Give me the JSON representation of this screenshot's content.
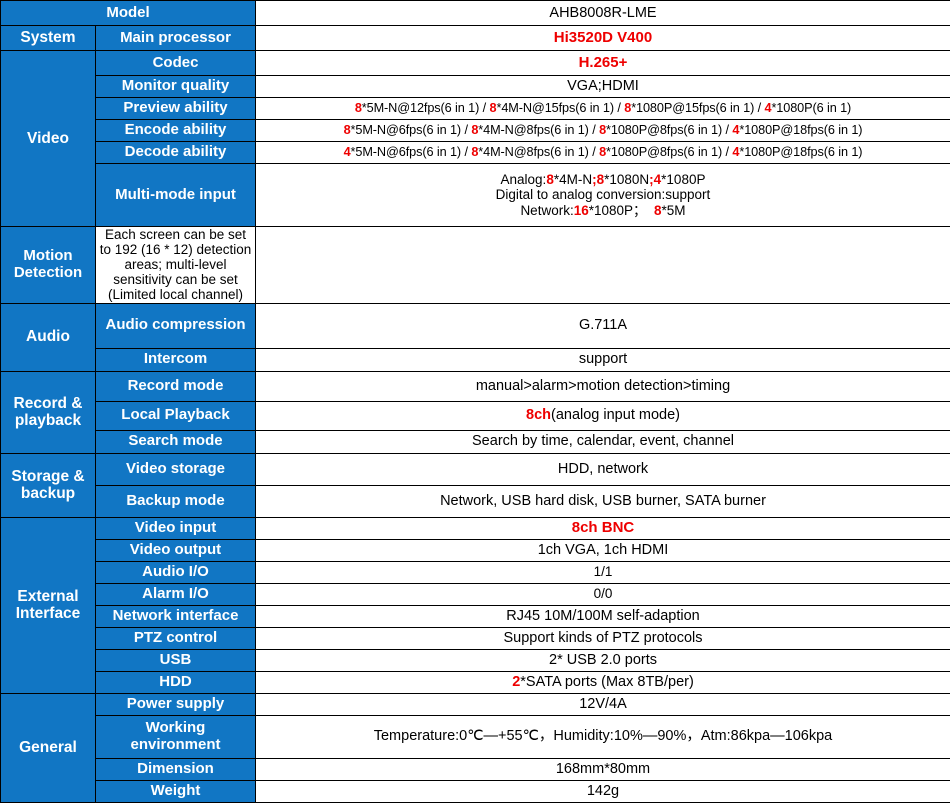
{
  "colors": {
    "label_blue": "#1176c4",
    "label_text": "#ffffff",
    "accent_red": "#ee0000",
    "border": "#000000",
    "value_bg": "#ffffff"
  },
  "categories": {
    "system": "System",
    "video": "Video",
    "audio": "Audio",
    "record_playback": "Record & playback",
    "storage_backup": "Storage & backup",
    "external_interface": "External Interface",
    "general": "General"
  },
  "rows": {
    "model": {
      "label": "Model",
      "value": "AHB8008R-LME"
    },
    "main_processor": {
      "label": "Main processor",
      "value": "Hi3520D V400"
    },
    "codec": {
      "label": "Codec",
      "value": "H.265+"
    },
    "monitor_quality": {
      "label": "Monitor quality",
      "value": "VGA;HDMI"
    },
    "preview_ability": {
      "label": "Preview ability",
      "value": "8*5M-N@12fps(6 in 1) / 8*4M-N@15fps(6 in 1) / 8*1080P@15fps(6 in 1) / 4*1080P(6 in 1)",
      "segments": [
        {
          "red": "8",
          "black": "*5M-N@12fps(6 in 1) / "
        },
        {
          "red": "8",
          "black": "*4M-N@15fps(6 in 1) / "
        },
        {
          "red": "8",
          "black": "*1080P@15fps(6 in 1) / "
        },
        {
          "red": "4",
          "black": "*1080P(6 in 1)"
        }
      ]
    },
    "encode_ability": {
      "label": "Encode ability",
      "value": "8*5M-N@6fps(6 in 1) / 8*4M-N@8fps(6 in 1) / 8*1080P@8fps(6 in 1) / 4*1080P@18fps(6 in 1)",
      "segments": [
        {
          "red": "8",
          "black": "*5M-N@6fps(6 in 1) / "
        },
        {
          "red": "8",
          "black": "*4M-N@8fps(6 in 1) / "
        },
        {
          "red": "8",
          "black": "*1080P@8fps(6 in 1) / "
        },
        {
          "red": "4",
          "black": "*1080P@18fps(6 in 1)"
        }
      ]
    },
    "decode_ability": {
      "label": "Decode ability",
      "value": "4*5M-N@6fps(6 in 1) / 8*4M-N@8fps(6 in 1) / 8*1080P@8fps(6 in 1) / 4*1080P@18fps(6 in 1)",
      "segments": [
        {
          "red": "4",
          "black": "*5M-N@6fps(6 in 1) / "
        },
        {
          "red": "8",
          "black": "*4M-N@8fps(6 in 1) / "
        },
        {
          "red": "8",
          "black": "*1080P@8fps(6 in 1) / "
        },
        {
          "red": "4",
          "black": "*1080P@18fps(6 in 1)"
        }
      ]
    },
    "multi_mode_input": {
      "label": "Multi-mode input",
      "line1_prefix": "Analog:",
      "line1_red1": "8",
      "line1_mid1": "*4M-N",
      "line1_semi1": ";",
      "line1_red2": "8",
      "line1_mid2": "*1080N",
      "line1_semi2": ";",
      "line1_red3": "4",
      "line1_end": "*1080P",
      "line2": "Digital to analog conversion:support",
      "line3_prefix": "Network:",
      "line3_red1": "16",
      "line3_mid": "*1080P；  ",
      "line3_red2": "8",
      "line3_end": "*5M"
    },
    "motion_detection": {
      "label": "Motion Detection",
      "value": "Each screen can be set to 192 (16 * 12) detection areas; multi-level sensitivity can be set (Limited local channel)"
    },
    "audio_compression": {
      "label": "Audio compression",
      "value": "G.711A"
    },
    "intercom": {
      "label": "Intercom",
      "value": "support"
    },
    "record_mode": {
      "label": "Record mode",
      "value": "manual>alarm>motion detection>timing"
    },
    "local_playback": {
      "label": "Local Playback",
      "value_red": "8ch",
      "value_black": "(analog input mode)"
    },
    "search_mode": {
      "label": "Search mode",
      "value": "Search by time, calendar, event, channel"
    },
    "video_storage": {
      "label": "Video storage",
      "value": "HDD, network"
    },
    "backup_mode": {
      "label": "Backup mode",
      "value": "Network, USB hard disk, USB burner, SATA burner"
    },
    "video_input": {
      "label": "Video input",
      "value": "8ch BNC"
    },
    "video_output": {
      "label": "Video output",
      "value": "1ch VGA, 1ch HDMI"
    },
    "audio_io": {
      "label": "Audio I/O",
      "value": "1/1"
    },
    "alarm_io": {
      "label": "Alarm I/O",
      "value": "0/0"
    },
    "network_interface": {
      "label": "Network interface",
      "value": "RJ45 10M/100M self-adaption"
    },
    "ptz_control": {
      "label": "PTZ control",
      "value": "Support kinds of PTZ protocols"
    },
    "usb": {
      "label": "USB",
      "value": "2* USB 2.0 ports"
    },
    "hdd": {
      "label": "HDD",
      "value_red": "2",
      "value_black": "*SATA ports (Max 8TB/per)"
    },
    "power_supply": {
      "label": "Power supply",
      "value": "12V/4A"
    },
    "working_environment": {
      "label": "Working environment",
      "value": "Temperature:0℃—+55℃，Humidity:10%—90%，Atm:86kpa—106kpa"
    },
    "dimension": {
      "label": "Dimension",
      "value": "168mm*80mm"
    },
    "weight": {
      "label": "Weight",
      "value": "142g"
    }
  }
}
